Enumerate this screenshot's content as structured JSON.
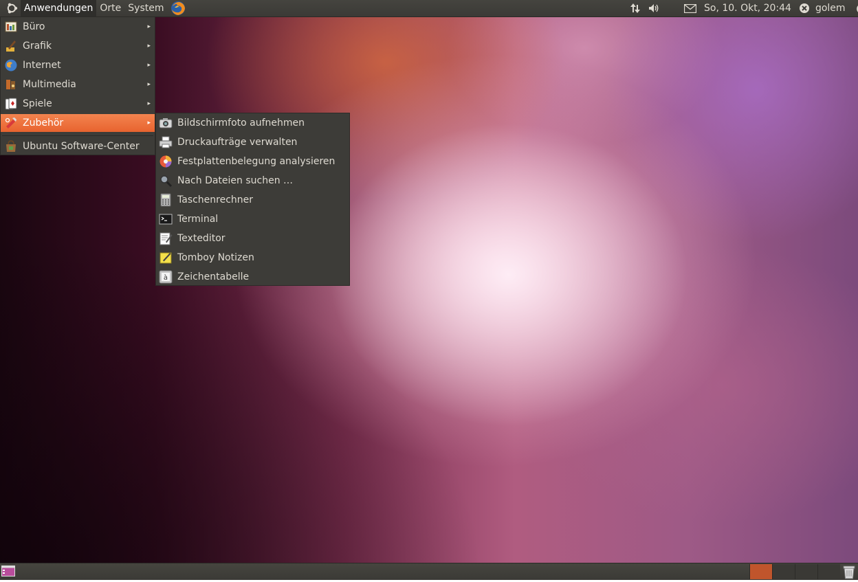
{
  "top_panel": {
    "menus": [
      "Anwendungen",
      "Orte",
      "System"
    ],
    "clock": "So, 10. Okt, 20:44",
    "user": "golem"
  },
  "app_menu": {
    "items": [
      {
        "label": "Büro",
        "icon": "office-icon",
        "has_submenu": true
      },
      {
        "label": "Grafik",
        "icon": "graphics-icon",
        "has_submenu": true
      },
      {
        "label": "Internet",
        "icon": "internet-icon",
        "has_submenu": true
      },
      {
        "label": "Multimedia",
        "icon": "multimedia-icon",
        "has_submenu": true
      },
      {
        "label": "Spiele",
        "icon": "games-icon",
        "has_submenu": true
      },
      {
        "label": "Zubehör",
        "icon": "accessories-icon",
        "has_submenu": true,
        "selected": true
      },
      {
        "label": "Ubuntu Software-Center",
        "icon": "software-center-icon",
        "has_submenu": false
      }
    ]
  },
  "submenu": {
    "items": [
      {
        "label": "Bildschirmfoto aufnehmen",
        "icon": "camera-icon"
      },
      {
        "label": "Druckaufträge verwalten",
        "icon": "printer-icon"
      },
      {
        "label": "Festplattenbelegung analysieren",
        "icon": "disk-usage-icon"
      },
      {
        "label": "Nach Dateien suchen …",
        "icon": "search-icon"
      },
      {
        "label": "Taschenrechner",
        "icon": "calculator-icon"
      },
      {
        "label": "Terminal",
        "icon": "terminal-icon"
      },
      {
        "label": "Texteditor",
        "icon": "text-editor-icon"
      },
      {
        "label": "Tomboy Notizen",
        "icon": "tomboy-notes-icon"
      },
      {
        "label": "Zeichentabelle",
        "icon": "character-map-icon"
      }
    ]
  },
  "bottom_panel": {
    "workspaces": 4,
    "active_workspace": 1
  },
  "colors": {
    "panel": "#3c3b37",
    "highlight": "#f07746",
    "text": "#dfdbd2"
  }
}
